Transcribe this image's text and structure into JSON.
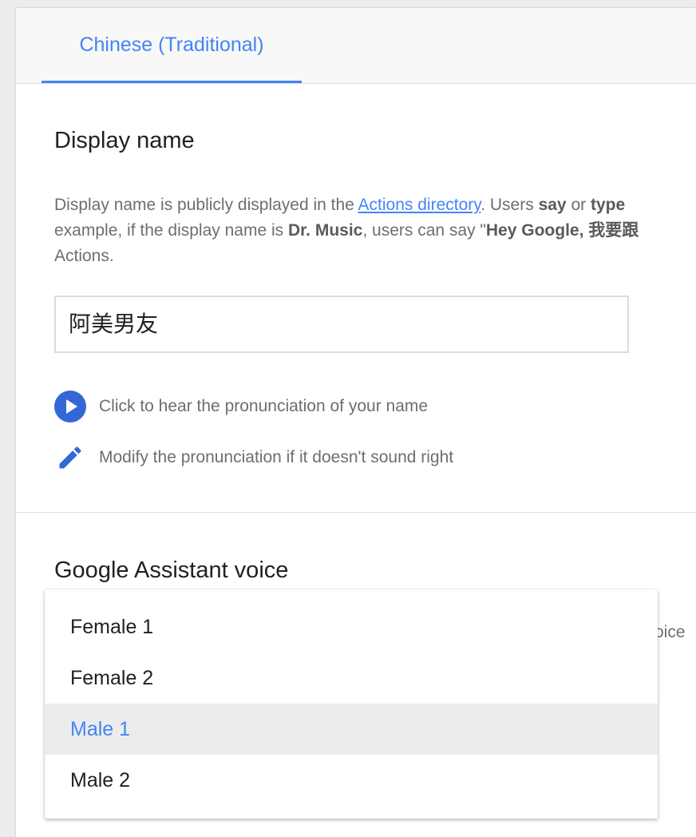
{
  "tabs": [
    {
      "label": "Chinese (Traditional)",
      "active": true
    }
  ],
  "display_name": {
    "title": "Display name",
    "desc": {
      "part1": "Display name is publicly displayed in the ",
      "link": "Actions directory",
      "part2": ". Users ",
      "say": "say",
      "or": " or ",
      "type": "type",
      "line2_part1": "example, if the display name is ",
      "dr_music": "Dr. Music",
      "line2_part2": ", users can say \"",
      "hey_google": "Hey Google, 我要跟",
      "line3": "Actions."
    },
    "input_value": "阿美男友",
    "hear_label": "Click to hear the pronunciation of your name",
    "modify_label": "Modify the pronunciation if it doesn't sound right"
  },
  "voice": {
    "title": "Google Assistant voice",
    "partial_text": "oice",
    "options": [
      "Female 1",
      "Female 2",
      "Male 1",
      "Male 2"
    ],
    "selected": "Male 1"
  },
  "colors": {
    "accent": "#4285f4",
    "play_button": "#3367d6",
    "selected_bg": "#ececec"
  },
  "icons": {
    "play": "play-circle-icon",
    "edit": "pencil-icon"
  }
}
